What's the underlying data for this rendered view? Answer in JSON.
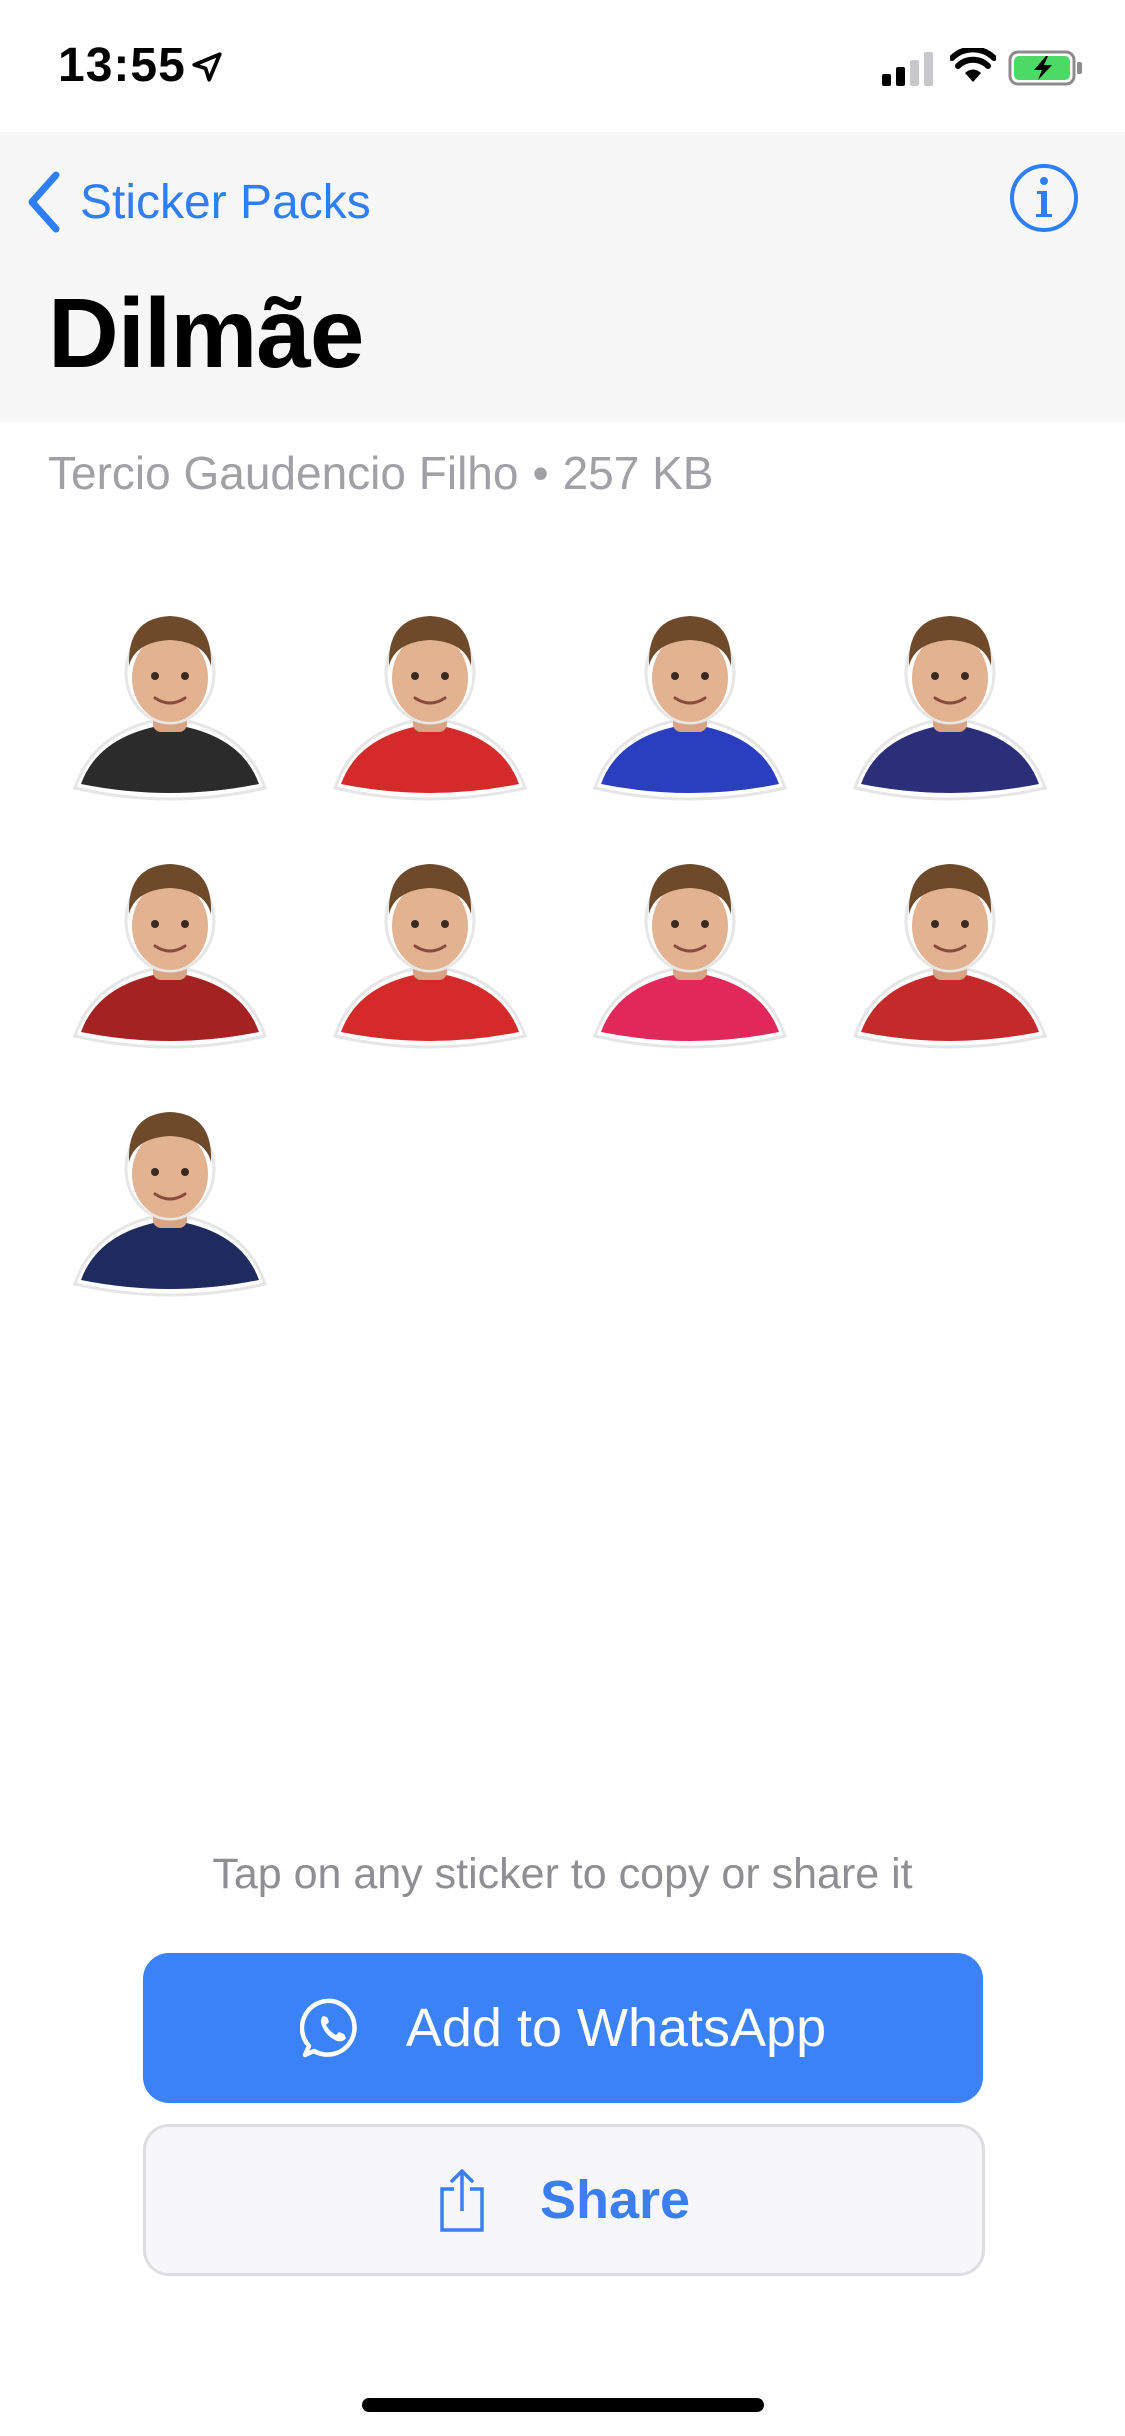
{
  "status_bar": {
    "time": "13:55",
    "icons": [
      "location-arrow-icon",
      "signal-icon",
      "wifi-icon",
      "battery-charging-icon"
    ]
  },
  "nav": {
    "back_label": "Sticker Packs",
    "back_icon": "chevron-left-icon",
    "info_icon": "info-icon",
    "title": "Dilmãe"
  },
  "pack": {
    "author": "Tercio Gaudencio Filho",
    "separator": "•",
    "size": "257 KB"
  },
  "stickers": [
    {
      "name": "sticker-1",
      "top_color": "#2b2b2b"
    },
    {
      "name": "sticker-2",
      "top_color": "#d42a2a"
    },
    {
      "name": "sticker-3",
      "top_color": "#2a3fbf"
    },
    {
      "name": "sticker-4",
      "top_color": "#2b2f7a"
    },
    {
      "name": "sticker-5",
      "top_color": "#a52222"
    },
    {
      "name": "sticker-6",
      "top_color": "#d42a2a"
    },
    {
      "name": "sticker-7",
      "top_color": "#e0285a"
    },
    {
      "name": "sticker-8",
      "top_color": "#c42a2a"
    },
    {
      "name": "sticker-9",
      "top_color": "#1f2a5e"
    }
  ],
  "footer": {
    "hint": "Tap on any sticker to copy or share it",
    "add_label": "Add to WhatsApp",
    "add_icon": "whatsapp-icon",
    "share_label": "Share",
    "share_icon": "share-icon"
  },
  "colors": {
    "accent": "#2f7ef5",
    "add_button": "#3b82f6",
    "secondary_text": "#a0a0a5"
  }
}
